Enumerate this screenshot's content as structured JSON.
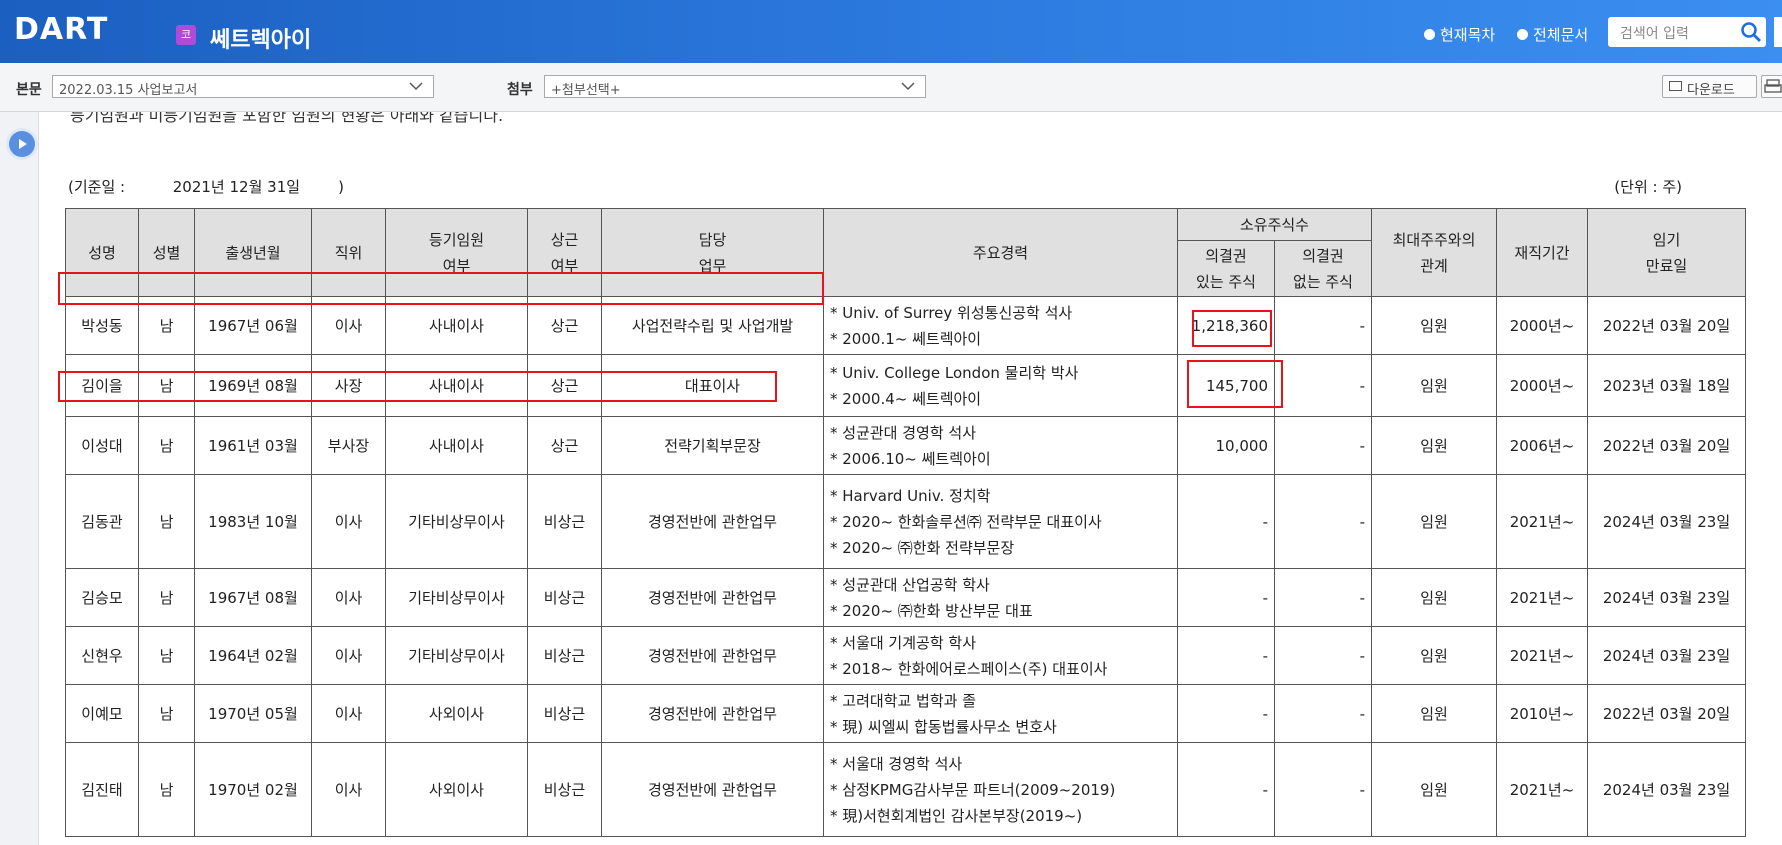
{
  "header": {
    "logo": "DART",
    "corp_badge": "코",
    "corp_name": "쎄트렉아이",
    "radio_options": [
      "현재목차",
      "전체문서"
    ],
    "search_placeholder": "검색어 입력"
  },
  "toolbar": {
    "main_label": "본문",
    "main_value": "2022.03.15  사업보고서",
    "attach_label": "첨부",
    "attach_value": "+첨부선택+",
    "download_label": "다운로드"
  },
  "doc": {
    "cut_line": "등기임원과 미등기임원을 포함한 임원의 현황은 아래와 같습니다.",
    "basis": "(기준일 :          2021년 12월 31일        )",
    "unit": "(단위 : 주)"
  },
  "table": {
    "headers": {
      "name": "성명",
      "gender": "성별",
      "birth": "출생년월",
      "position": "직위",
      "registered_line1": "등기임원",
      "registered_line2": "여부",
      "fulltime_line1": "상근",
      "fulltime_line2": "여부",
      "duty_line1": "담당",
      "duty_line2": "업무",
      "career": "주요경력",
      "shares": "소유주식수",
      "voting_line1": "의결권",
      "voting_line2": "있는 주식",
      "nonvoting_line1": "의결권",
      "nonvoting_line2": "없는 주식",
      "relation_line1": "최대주주와의",
      "relation_line2": "관계",
      "tenure": "재직기간",
      "term_line1": "임기",
      "term_line2": "만료일"
    },
    "rows": [
      {
        "name": "박성동",
        "gender": "남",
        "birth": "1967년 06월",
        "position": "이사",
        "registered": "사내이사",
        "fulltime": "상근",
        "duty": "사업전략수립 및 사업개발",
        "career": [
          "* Univ. of Surrey 위성통신공학 석사",
          "* 2000.1~ 쎄트렉아이"
        ],
        "voting": "1,218,360",
        "nonvoting": "-",
        "relation": "임원",
        "tenure": "2000년~",
        "term": "2022년 03월 20일"
      },
      {
        "name": "김이을",
        "gender": "남",
        "birth": "1969년 08월",
        "position": "사장",
        "registered": "사내이사",
        "fulltime": "상근",
        "duty": "대표이사",
        "career": [
          "* Univ. College London 물리학 박사",
          "* 2000.4~ 쎄트렉아이"
        ],
        "voting": "145,700",
        "nonvoting": "-",
        "relation": "임원",
        "tenure": "2000년~",
        "term": "2023년 03월 18일"
      },
      {
        "name": "이성대",
        "gender": "남",
        "birth": "1961년 03월",
        "position": "부사장",
        "registered": "사내이사",
        "fulltime": "상근",
        "duty": "전략기획부문장",
        "career": [
          "* 성균관대 경영학 석사",
          "* 2006.10~ 쎄트렉아이"
        ],
        "voting": "10,000",
        "nonvoting": "-",
        "relation": "임원",
        "tenure": "2006년~",
        "term": "2022년 03월 20일"
      },
      {
        "name": "김동관",
        "gender": "남",
        "birth": "1983년 10월",
        "position": "이사",
        "registered": "기타비상무이사",
        "fulltime": "비상근",
        "duty": "경영전반에 관한업무",
        "career": [
          "* Harvard Univ. 정치학",
          "* 2020~ 한화솔루션㈜ 전략부문 대표이사",
          "* 2020~ ㈜한화 전략부문장"
        ],
        "voting": "-",
        "nonvoting": "-",
        "relation": "임원",
        "tenure": "2021년~",
        "term": "2024년 03월 23일"
      },
      {
        "name": "김승모",
        "gender": "남",
        "birth": "1967년 08월",
        "position": "이사",
        "registered": "기타비상무이사",
        "fulltime": "비상근",
        "duty": "경영전반에 관한업무",
        "career": [
          "* 성균관대 산업공학 학사",
          "* 2020~ ㈜한화 방산부문 대표"
        ],
        "voting": "-",
        "nonvoting": "-",
        "relation": "임원",
        "tenure": "2021년~",
        "term": "2024년 03월 23일"
      },
      {
        "name": "신현우",
        "gender": "남",
        "birth": "1964년 02월",
        "position": "이사",
        "registered": "기타비상무이사",
        "fulltime": "비상근",
        "duty": "경영전반에 관한업무",
        "career": [
          "* 서울대 기계공학 학사",
          "* 2018~ 한화에어로스페이스(주) 대표이사"
        ],
        "voting": "-",
        "nonvoting": "-",
        "relation": "임원",
        "tenure": "2021년~",
        "term": "2024년 03월 23일"
      },
      {
        "name": "이예모",
        "gender": "남",
        "birth": "1970년 05월",
        "position": "이사",
        "registered": "사외이사",
        "fulltime": "비상근",
        "duty": "경영전반에 관한업무",
        "career": [
          "* 고려대학교 법학과 졸",
          "* 現) 씨엘씨 합동법률사무소 변호사"
        ],
        "voting": "-",
        "nonvoting": "-",
        "relation": "임원",
        "tenure": "2010년~",
        "term": "2022년 03월 20일"
      },
      {
        "name": "김진태",
        "gender": "남",
        "birth": "1970년 02월",
        "position": "이사",
        "registered": "사외이사",
        "fulltime": "비상근",
        "duty": "경영전반에 관한업무",
        "career": [
          "* 서울대 경영학 석사",
          "* 삼정KPMG감사부문 파트너(2009~2019)",
          "* 現)서현회계법인 감사본부장(2019~)"
        ],
        "voting": "-",
        "nonvoting": "-",
        "relation": "임원",
        "tenure": "2021년~",
        "term": "2024년 03월 23일"
      }
    ]
  },
  "colors": {
    "header_blue": "#2a72d8",
    "highlight_red": "#e8141c",
    "table_header_bg": "#e0e0e0"
  }
}
